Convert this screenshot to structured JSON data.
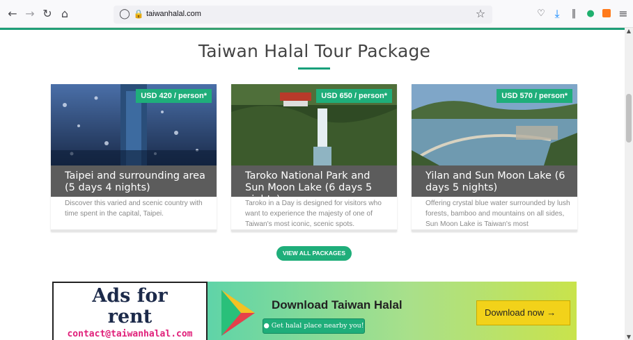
{
  "browser": {
    "url": "taiwanhalal.com",
    "icons": [
      "back-icon",
      "forward-icon",
      "reload-icon",
      "home-icon",
      "shield-icon",
      "lock-icon",
      "star-icon",
      "pocket-icon",
      "download-icon",
      "library-icon",
      "extension-green-icon",
      "extension-sc-icon",
      "menu-icon"
    ]
  },
  "section": {
    "title": "Taiwan Halal Tour Package"
  },
  "packages": [
    {
      "price": "USD 420 / person*",
      "title": "Taipei and surrounding area (5 days 4 nights)",
      "description": "Discover this varied and scenic country with time spent in the capital, Taipei."
    },
    {
      "price": "USD 650 / person*",
      "title": "Taroko National Park and Sun Moon Lake (6 days 5 nights)",
      "description": "Taroko in a Day is designed for visitors who want to experience the majesty of one of Taiwan's most iconic, scenic spots."
    },
    {
      "price": "USD 570 / person*",
      "title": "Yilan and Sun Moon Lake (6 days 5 nights)",
      "description": "Offering crystal blue water surrounded by lush forests, bamboo and mountains on all sides, Sun Moon Lake is Taiwan's most"
    }
  ],
  "view_all_label": "VIEW ALL PACKAGES",
  "banner": {
    "ads_line1": "Ads for",
    "ads_line2": "rent",
    "contact": "contact@taiwanhalal.com",
    "download_title": "Download Taiwan Halal",
    "download_button": "Download now"
  },
  "nearby_label": "Get halal place nearby you!",
  "colors": {
    "accent": "#1fae7a",
    "card_header": "#5c5c5c",
    "download_button": "#f2d21a"
  }
}
